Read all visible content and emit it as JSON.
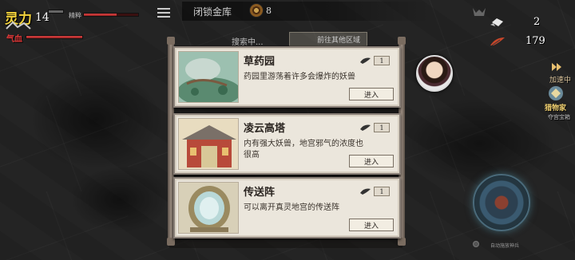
{
  "hud": {
    "spirit_label": "灵力",
    "spirit_value": "14",
    "spirit_bar_fraction": 0.6,
    "spirit_extra": "精粹",
    "blood_label": "气血",
    "blood_bar_fraction": 1.0
  },
  "top": {
    "lock_text": "闭锁金库",
    "coin_value": "8",
    "search_text": "搜索中...",
    "goto_button": "前往其他区域"
  },
  "resources": [
    {
      "icon": "gem-icon",
      "value": "2"
    },
    {
      "icon": "feather-icon",
      "value": "179"
    }
  ],
  "cards": [
    {
      "title": "草药园",
      "desc": "药园里游荡着许多会爆炸的妖兽",
      "cost": "1",
      "enter": "进入",
      "image": "herb-garden-image"
    },
    {
      "title": "凌云高塔",
      "desc": "内有强大妖兽，地宫邪气的浓度也很高",
      "cost": "1",
      "enter": "进入",
      "image": "tower-image"
    },
    {
      "title": "传送阵",
      "desc": "可以离开真灵地宫的传送阵",
      "cost": "1",
      "enter": "进入",
      "image": "portal-image"
    }
  ],
  "side": {
    "speed_label": "加速中",
    "skill_label": "猎物家",
    "sublabel": "夺宫宝箱",
    "auto_text": "自动施放神兵"
  },
  "colors": {
    "accent_gold": "#f2d23c",
    "blood_red": "#e03a3a",
    "card_bg": "#ebe6dc"
  }
}
